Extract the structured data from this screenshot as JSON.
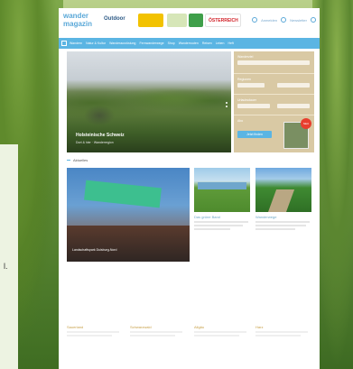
{
  "side": {
    "letter": "l."
  },
  "header": {
    "logo_line1": "wander",
    "logo_line2": "magazin",
    "outdoor": "Outdoor",
    "partner_oesterreich": "ÖSTERREICH",
    "link1": "Anmelden",
    "link2": "Newsletter"
  },
  "nav": {
    "items": [
      "Wandern",
      "Natur & Kultur",
      "Wanderausrüstung",
      "Fernwanderwege",
      "Shop",
      "Wanderrouten",
      "Reisen",
      "Leben",
      "Heft"
    ]
  },
  "hero": {
    "title": "Holsteinische Schweiz",
    "subtitle": "Dort & hier · Wanderregion"
  },
  "form": {
    "label1": "Wanderziel",
    "label2": "Regionen",
    "label3": "Urlaubsdauer",
    "mag_label": "Abo",
    "badge": "NEU",
    "button": "Jetzt finden"
  },
  "section": {
    "title": "Aktuelles"
  },
  "cards": {
    "big_caption": "Landschaftspark Duisburg-Nord",
    "small1_title": "Das grüne Band",
    "small2_title": "Wanderwege"
  },
  "bottom": {
    "titles": [
      "Sauerland",
      "Schwarzwald",
      "Allgäu",
      "Harz"
    ]
  }
}
